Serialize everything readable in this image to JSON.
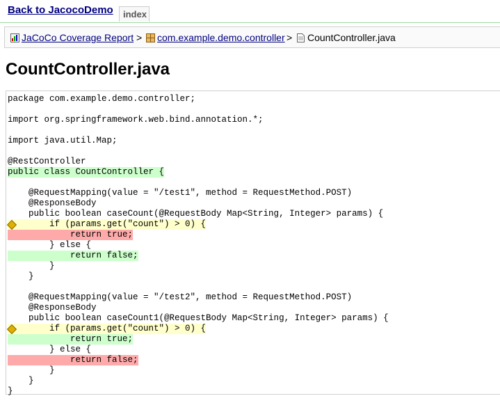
{
  "header": {
    "back_link": "Back to JacocoDemo",
    "index_tab": "index"
  },
  "breadcrumb": {
    "report": "JaCoCo Coverage Report",
    "package": "com.example.demo.controller",
    "file": "CountController.java",
    "separator": ">"
  },
  "page_title": "CountController.java",
  "colors": {
    "fully_covered": "#ccffcc",
    "not_covered": "#ffaaaa",
    "partly_covered": "#ffffcc"
  },
  "source_lines": [
    {
      "text": "package com.example.demo.controller;",
      "status": "none"
    },
    {
      "text": "",
      "status": "none"
    },
    {
      "text": "import org.springframework.web.bind.annotation.*;",
      "status": "none"
    },
    {
      "text": "",
      "status": "none"
    },
    {
      "text": "import java.util.Map;",
      "status": "none"
    },
    {
      "text": "",
      "status": "none"
    },
    {
      "text": "@RestController",
      "status": "none"
    },
    {
      "text": "public class CountController {",
      "status": "fc"
    },
    {
      "text": "",
      "status": "none"
    },
    {
      "text": "    @RequestMapping(value = \"/test1\", method = RequestMethod.POST)",
      "status": "none"
    },
    {
      "text": "    @ResponseBody",
      "status": "none"
    },
    {
      "text": "    public boolean caseCount(@RequestBody Map<String, Integer> params) {",
      "status": "none"
    },
    {
      "text": "        if (params.get(\"count\") > 0) {",
      "status": "pc",
      "branch_icon": "diamond-icon"
    },
    {
      "text": "            return true;",
      "status": "nc"
    },
    {
      "text": "        } else {",
      "status": "none"
    },
    {
      "text": "            return false;",
      "status": "fc"
    },
    {
      "text": "        }",
      "status": "none"
    },
    {
      "text": "    }",
      "status": "none"
    },
    {
      "text": "",
      "status": "none"
    },
    {
      "text": "    @RequestMapping(value = \"/test2\", method = RequestMethod.POST)",
      "status": "none"
    },
    {
      "text": "    @ResponseBody",
      "status": "none"
    },
    {
      "text": "    public boolean caseCount1(@RequestBody Map<String, Integer> params) {",
      "status": "none"
    },
    {
      "text": "        if (params.get(\"count\") > 0) {",
      "status": "pc",
      "branch_icon": "diamond-icon"
    },
    {
      "text": "            return true;",
      "status": "fc"
    },
    {
      "text": "        } else {",
      "status": "none"
    },
    {
      "text": "            return false;",
      "status": "nc"
    },
    {
      "text": "        }",
      "status": "none"
    },
    {
      "text": "    }",
      "status": "none"
    },
    {
      "text": "}",
      "status": "none"
    }
  ]
}
